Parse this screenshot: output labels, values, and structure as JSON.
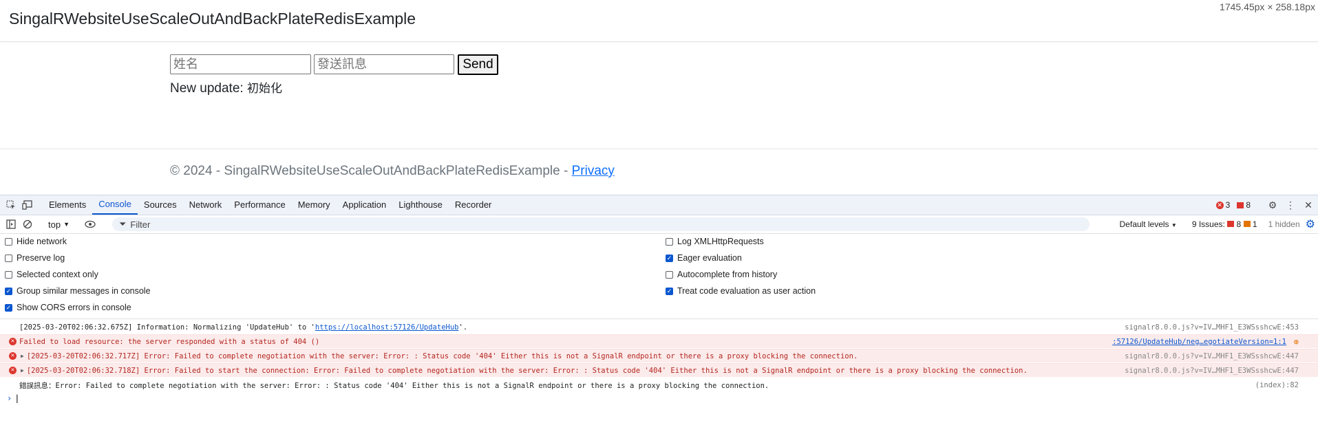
{
  "site": {
    "brand": "SingalRWebsiteUseScaleOutAndBackPlateRedisExample",
    "dims_overlay": "1745.45px × 258.18px",
    "name_placeholder": "姓名",
    "message_placeholder": "發送訊息",
    "send_label": "Send",
    "update_prefix": "New update: ",
    "update_value": "初始化",
    "footer_text": "© 2024 - SingalRWebsiteUseScaleOutAndBackPlateRedisExample - ",
    "footer_link": "Privacy"
  },
  "devtools": {
    "tabs": [
      "Elements",
      "Console",
      "Sources",
      "Network",
      "Performance",
      "Memory",
      "Application",
      "Lighthouse",
      "Recorder"
    ],
    "active_tab": "Console",
    "error_count": "3",
    "issue_count": "8",
    "context": "top",
    "filter_placeholder": "Filter",
    "levels": "Default levels",
    "issues_label": "9 Issues:",
    "issues_red": "8",
    "issues_orange": "1",
    "hidden": "1 hidden",
    "settings_left": [
      {
        "label": "Hide network",
        "checked": false
      },
      {
        "label": "Preserve log",
        "checked": false
      },
      {
        "label": "Selected context only",
        "checked": false
      },
      {
        "label": "Group similar messages in console",
        "checked": true
      },
      {
        "label": "Show CORS errors in console",
        "checked": true
      }
    ],
    "settings_right": [
      {
        "label": "Log XMLHttpRequests",
        "checked": false
      },
      {
        "label": "Eager evaluation",
        "checked": true
      },
      {
        "label": "Autocomplete from history",
        "checked": false
      },
      {
        "label": "Treat code evaluation as user action",
        "checked": true
      }
    ],
    "messages": [
      {
        "type": "info",
        "text_pre": "[2025-03-20T02:06:32.675Z] Information: Normalizing 'UpdateHub' to '",
        "link": "https://localhost:57126/UpdateHub",
        "text_post": "'.",
        "source": "signalr8.0.0.js?v=IV…MHF1_E3WSsshcwE:453"
      },
      {
        "type": "error",
        "text_pre": "Failed to load resource: the server responded with a status of 404 ()",
        "source_link": ":57126/UpdateHub/neg…egotiateVersion=1:1"
      },
      {
        "type": "error",
        "expand": true,
        "text_pre": "[2025-03-20T02:06:32.717Z] Error: Failed to complete negotiation with the server: Error: : Status code '404' Either this is not a SignalR endpoint or there is a proxy blocking the connection.",
        "source": "signalr8.0.0.js?v=IV…MHF1_E3WSsshcwE:447"
      },
      {
        "type": "error",
        "expand": true,
        "text_pre": "[2025-03-20T02:06:32.718Z] Error: Failed to start the connection: Error: Failed to complete negotiation with the server: Error: : Status code '404' Either this is not a SignalR endpoint or there is a proxy blocking the connection.",
        "source": "signalr8.0.0.js?v=IV…MHF1_E3WSsshcwE:447"
      },
      {
        "type": "info",
        "text_pre": "錯誤訊息：Error: Failed to complete negotiation with the server: Error: : Status code '404' Either this is not a SignalR endpoint or there is a proxy blocking the connection.",
        "source": "(index):82"
      }
    ]
  }
}
